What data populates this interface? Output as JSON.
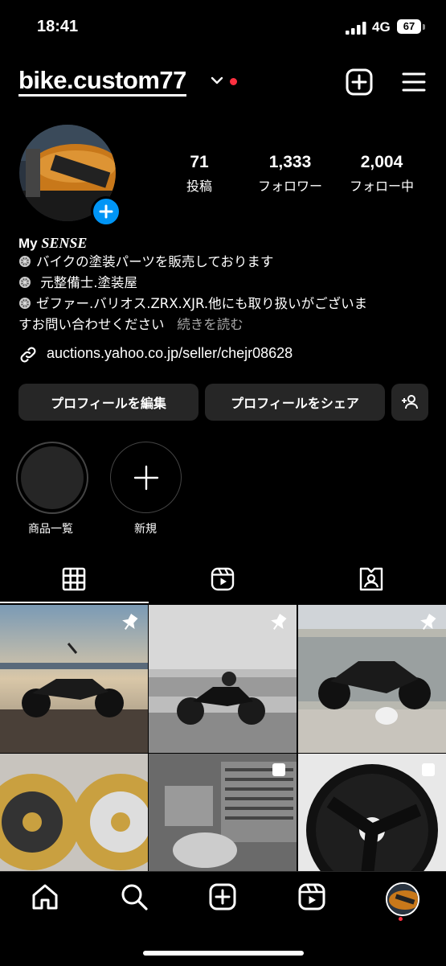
{
  "status_bar": {
    "time": "18:41",
    "network": "4G",
    "battery": "67"
  },
  "header": {
    "username": "bike.custom77"
  },
  "stats": [
    {
      "count": "71",
      "label": "投稿"
    },
    {
      "count": "1,333",
      "label": "フォロワー"
    },
    {
      "count": "2,004",
      "label": "フォロー中"
    }
  ],
  "bio": {
    "name_prefix": "My ",
    "name_italic": "SENSE",
    "line1": "バイクの塗装パーツを販売しております",
    "line2": " 元整備士.塗装屋",
    "line3": "ゼファー.バリオス.ZRX.XJR.他にも取り扱いがございま",
    "line4": "すお問い合わせください",
    "more": "続きを読む",
    "link": "auctions.yahoo.co.jp/seller/chejr08628"
  },
  "buttons": {
    "edit_profile": "プロフィールを編集",
    "share_profile": "プロフィールをシェア"
  },
  "highlights": [
    {
      "label": "商品一覧"
    },
    {
      "label": "新規"
    }
  ],
  "icons": {
    "add_post": "plus-square-icon",
    "menu": "hamburger-icon",
    "grid_tab": "grid-icon",
    "reels_tab": "reels-icon",
    "tagged_tab": "tagged-icon"
  },
  "colors": {
    "accent": "#0095f6",
    "notification": "#ff3040",
    "button_bg": "#262626"
  }
}
